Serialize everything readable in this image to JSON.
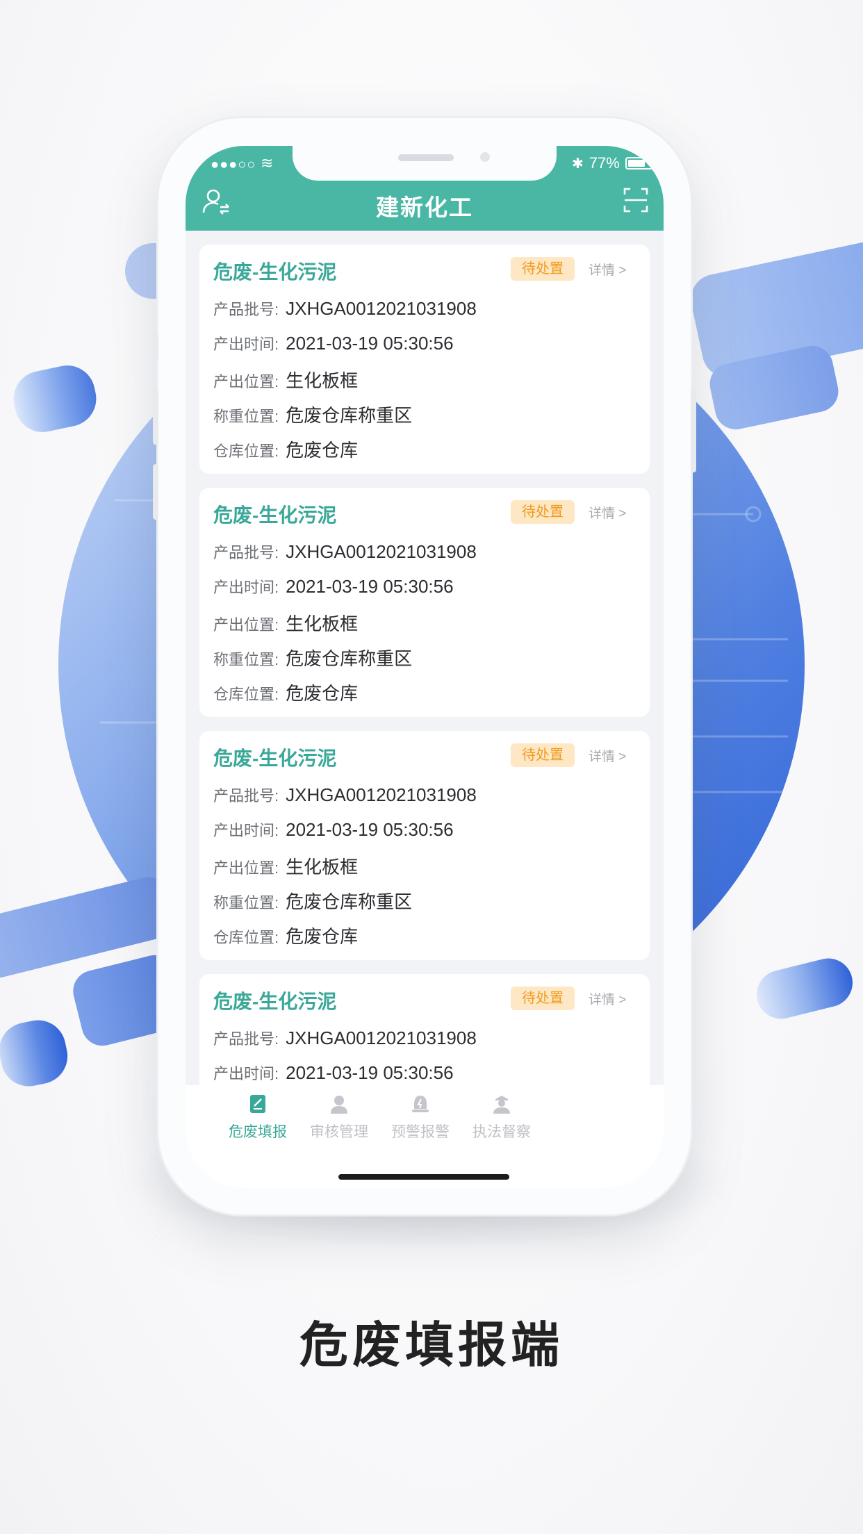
{
  "status_bar": {
    "signal": "●●●○○",
    "battery": "77%"
  },
  "header": {
    "title": "建新化工"
  },
  "cards": [
    {
      "title": "危废-生化污泥",
      "badge": "待处置",
      "detail": "详情 >",
      "rows": [
        {
          "key": "产品批号:",
          "value": "JXHGA0012021031908"
        },
        {
          "key": "产出时间:",
          "value": "2021-03-19  05:30:56"
        },
        {
          "key": "产出位置:",
          "value": "生化板框"
        },
        {
          "key": "称重位置:",
          "value": "危废仓库称重区"
        },
        {
          "key": "仓库位置:",
          "value": "危废仓库"
        }
      ]
    },
    {
      "title": "危废-生化污泥",
      "badge": "待处置",
      "detail": "详情 >",
      "rows": [
        {
          "key": "产品批号:",
          "value": "JXHGA0012021031908"
        },
        {
          "key": "产出时间:",
          "value": "2021-03-19  05:30:56"
        },
        {
          "key": "产出位置:",
          "value": "生化板框"
        },
        {
          "key": "称重位置:",
          "value": "危废仓库称重区"
        },
        {
          "key": "仓库位置:",
          "value": "危废仓库"
        }
      ]
    },
    {
      "title": "危废-生化污泥",
      "badge": "待处置",
      "detail": "详情 >",
      "rows": [
        {
          "key": "产品批号:",
          "value": "JXHGA0012021031908"
        },
        {
          "key": "产出时间:",
          "value": "2021-03-19  05:30:56"
        },
        {
          "key": "产出位置:",
          "value": "生化板框"
        },
        {
          "key": "称重位置:",
          "value": "危废仓库称重区"
        },
        {
          "key": "仓库位置:",
          "value": "危废仓库"
        }
      ]
    },
    {
      "title": "危废-生化污泥",
      "badge": "待处置",
      "detail": "详情 >",
      "rows": [
        {
          "key": "产品批号:",
          "value": "JXHGA0012021031908"
        },
        {
          "key": "产出时间:",
          "value": "2021-03-19  05:30:56"
        }
      ]
    }
  ],
  "tabs": [
    {
      "label": "危废填报",
      "icon": "form-edit-icon",
      "active": true
    },
    {
      "label": "审核管理",
      "icon": "user-review-icon",
      "active": false
    },
    {
      "label": "预警报警",
      "icon": "alarm-bell-icon",
      "active": false
    },
    {
      "label": "执法督察",
      "icon": "officer-icon",
      "active": false
    }
  ],
  "caption": "危废填报端",
  "colors": {
    "header": "#4ab7a5",
    "accent": "#3aa898",
    "badge_bg": "#fde7c4",
    "badge_text": "#f39a1c"
  }
}
